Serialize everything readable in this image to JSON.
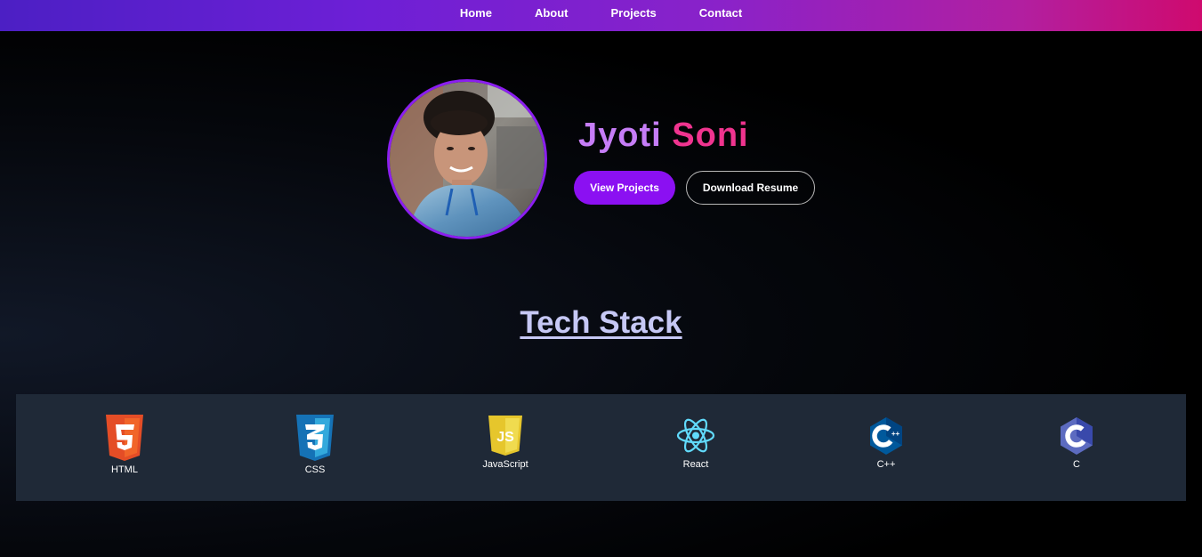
{
  "nav": {
    "items": [
      {
        "label": "Home"
      },
      {
        "label": "About"
      },
      {
        "label": "Projects"
      },
      {
        "label": "Contact"
      }
    ]
  },
  "hero": {
    "first_name": "Jyoti",
    "last_name": "Soni",
    "primary_button": "View Projects",
    "secondary_button": "Download Resume"
  },
  "tech_stack": {
    "title": "Tech Stack",
    "items": [
      {
        "label": "HTML",
        "icon": "html5-icon",
        "color": "#e44d26"
      },
      {
        "label": "CSS",
        "icon": "css3-icon",
        "color": "#1572b6"
      },
      {
        "label": "JavaScript",
        "icon": "javascript-icon",
        "color": "#f0db4f"
      },
      {
        "label": "React",
        "icon": "react-icon",
        "color": "#61dafb"
      },
      {
        "label": "C++",
        "icon": "cplusplus-icon",
        "color": "#00599c"
      },
      {
        "label": "C",
        "icon": "c-language-icon",
        "color": "#5c6bc0"
      }
    ]
  },
  "colors": {
    "accent": "#8b10f2",
    "name_first": "#c67df7",
    "name_last": "#f0348f",
    "panel": "#1f2937"
  }
}
